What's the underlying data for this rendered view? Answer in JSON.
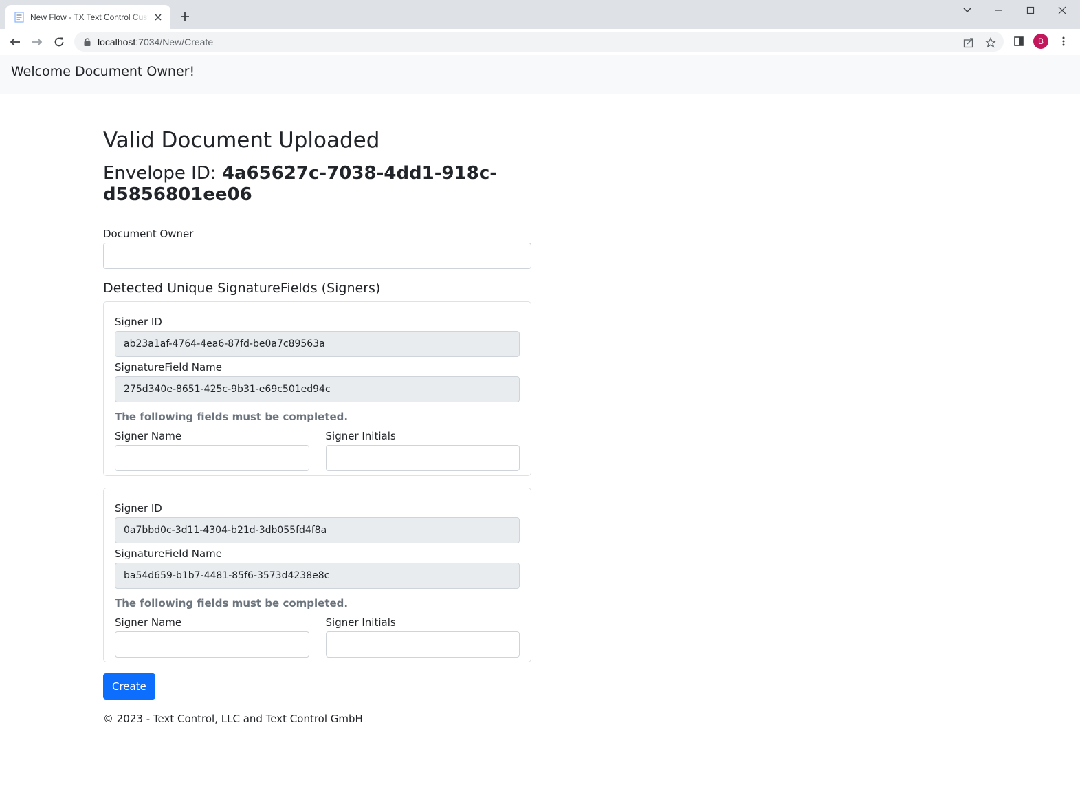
{
  "browser": {
    "tab_title": "New Flow - TX Text Control Custom",
    "url_host": "localhost",
    "url_path": ":7034/New/Create",
    "profile_initial": "B"
  },
  "navbar": {
    "brand": "Welcome Document Owner!"
  },
  "page": {
    "title": "Valid Document Uploaded",
    "envelope_label": "Envelope ID: ",
    "envelope_id": "4a65627c-7038-4dd1-918c-d5856801ee06"
  },
  "owner": {
    "label": "Document Owner",
    "value": ""
  },
  "signers_heading": "Detected Unique SignatureFields (Signers)",
  "signers": [
    {
      "signer_id_label": "Signer ID",
      "signer_id": "ab23a1af-4764-4ea6-87fd-be0a7c89563a",
      "field_name_label": "SignatureField Name",
      "field_name": "275d340e-8651-425c-9b31-e69c501ed94c",
      "hint": "The following fields must be completed.",
      "name_label": "Signer Name",
      "initials_label": "Signer Initials"
    },
    {
      "signer_id_label": "Signer ID",
      "signer_id": "0a7bbd0c-3d11-4304-b21d-3db055fd4f8a",
      "field_name_label": "SignatureField Name",
      "field_name": "ba54d659-b1b7-4481-85f6-3573d4238e8c",
      "hint": "The following fields must be completed.",
      "name_label": "Signer Name",
      "initials_label": "Signer Initials"
    }
  ],
  "create_button": "Create",
  "footer": "© 2023 - Text Control, LLC and Text Control GmbH",
  "colors": {
    "primary": "#0d6efd",
    "avatar": "#c2185b",
    "muted": "#6c757d"
  }
}
